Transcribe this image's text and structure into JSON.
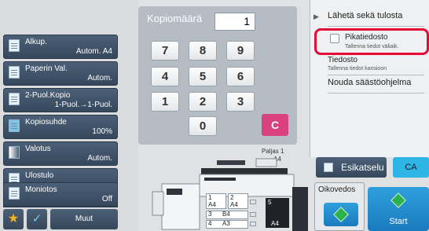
{
  "left_keys": [
    {
      "label": "Alkup.",
      "value": "Autom.   A4"
    },
    {
      "label": "Paperin Val.",
      "value": "Autom."
    },
    {
      "label": "2-Puol.Kopio",
      "value": "1-Puol.→1-Puol."
    },
    {
      "label": "Kopiosuhde",
      "value": "100%"
    },
    {
      "label": "Valotus",
      "value": "Autom."
    },
    {
      "label": "Ulostulo",
      "value": ""
    },
    {
      "label": "Moniotos",
      "value": "Off"
    }
  ],
  "bottom_bar": {
    "more_label": "Muut",
    "favorite_icon": "star-icon",
    "check_icon": "checkmark-icon"
  },
  "keypad": {
    "title": "Kopiomäärä",
    "count": "1",
    "keys": [
      "7",
      "8",
      "9",
      "4",
      "5",
      "6",
      "1",
      "2",
      "3",
      "0"
    ],
    "clear_label": "C"
  },
  "machine": {
    "output_label": "Paljas 1",
    "output_size": "A4",
    "trays": [
      {
        "num": "1",
        "size": "A4"
      },
      {
        "num": "2",
        "size": "A4"
      },
      {
        "num": "3",
        "size": "B4"
      },
      {
        "num": "4",
        "size": "A3"
      },
      {
        "num": "5",
        "size": "A4"
      }
    ]
  },
  "right_panel": {
    "items": [
      {
        "title": "Lähetä sekä tulosta",
        "sub": ""
      },
      {
        "title": "Pikatiedosto",
        "sub": "Tallenna tiedot väliaik."
      },
      {
        "title": "Tiedosto",
        "sub": "Tallenna tiedot kansioon"
      },
      {
        "title": "Nouda säästöohjelma",
        "sub": ""
      }
    ]
  },
  "actions": {
    "preview_label": "Esikatselu",
    "ca_label": "CA",
    "sample_label": "Oikovedos",
    "start_label": "Start"
  },
  "colors": {
    "highlight": "#e40a37",
    "start": "#1a7bbf",
    "ca": "#2db5e5",
    "clear": "#d9427e"
  }
}
